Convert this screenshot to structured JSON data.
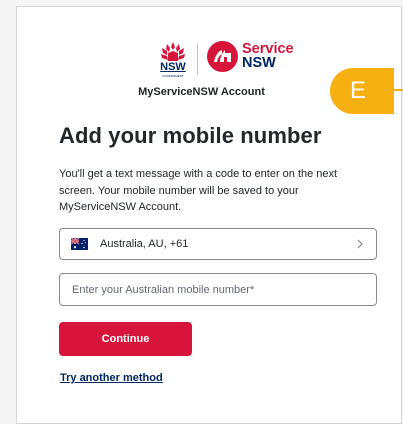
{
  "header": {
    "nsw_logo_text": "NSW",
    "nsw_logo_subtext": "GOVERNMENT",
    "service_nsw_line1": "Service",
    "service_nsw_line2": "NSW",
    "account_label": "MyServiceNSW Account"
  },
  "main": {
    "heading": "Add your mobile number",
    "description": "You'll get a text message with a code to enter on the next screen. Your mobile number will be saved to your MyServiceNSW Account."
  },
  "form": {
    "country_flag_icon": "australia-flag-icon",
    "country_value": "Australia, AU, +61",
    "country_chevron_icon": "chevron-right-icon",
    "mobile_placeholder": "Enter your Australian mobile number*",
    "mobile_value": "",
    "continue_label": "Continue",
    "try_another_label": "Try another method"
  },
  "annotation": {
    "label": "E",
    "color": "#f6b012"
  },
  "colors": {
    "primary_red": "#d7153a",
    "nsw_navy": "#002664",
    "text": "#22272b",
    "border": "#8b8b8b"
  }
}
